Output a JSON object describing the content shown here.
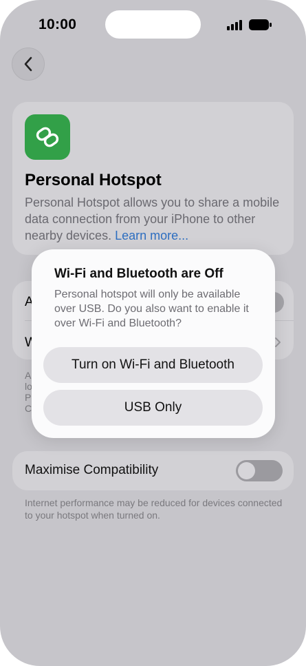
{
  "status_bar": {
    "time": "10:00"
  },
  "hero": {
    "title": "Personal Hotspot",
    "description": "Personal Hotspot allows you to share a mobile data connection from your iPhone to other nearby devices.",
    "link": "Learn more..."
  },
  "settings_partial": {
    "row1_initial": "A",
    "row2_initial": "W",
    "footer_initials": [
      "A",
      "lo",
      "Pe",
      "Co"
    ]
  },
  "compat": {
    "label": "Maximise Compatibility",
    "enabled": false,
    "footer": "Internet performance may be reduced for devices connected to your hotspot when turned on."
  },
  "alert": {
    "title": "Wi-Fi and Bluetooth are Off",
    "message": "Personal hotspot will only be available over USB. Do you also want to enable it over Wi-Fi and Bluetooth?",
    "primary_button": "Turn on Wi-Fi and Bluetooth",
    "secondary_button": "USB Only"
  },
  "colors": {
    "background": "#c6c5ca",
    "card": "#d2d1d5",
    "accent_green": "#32a048",
    "link": "#2d6ec0",
    "alert": "#fbfbfc"
  }
}
